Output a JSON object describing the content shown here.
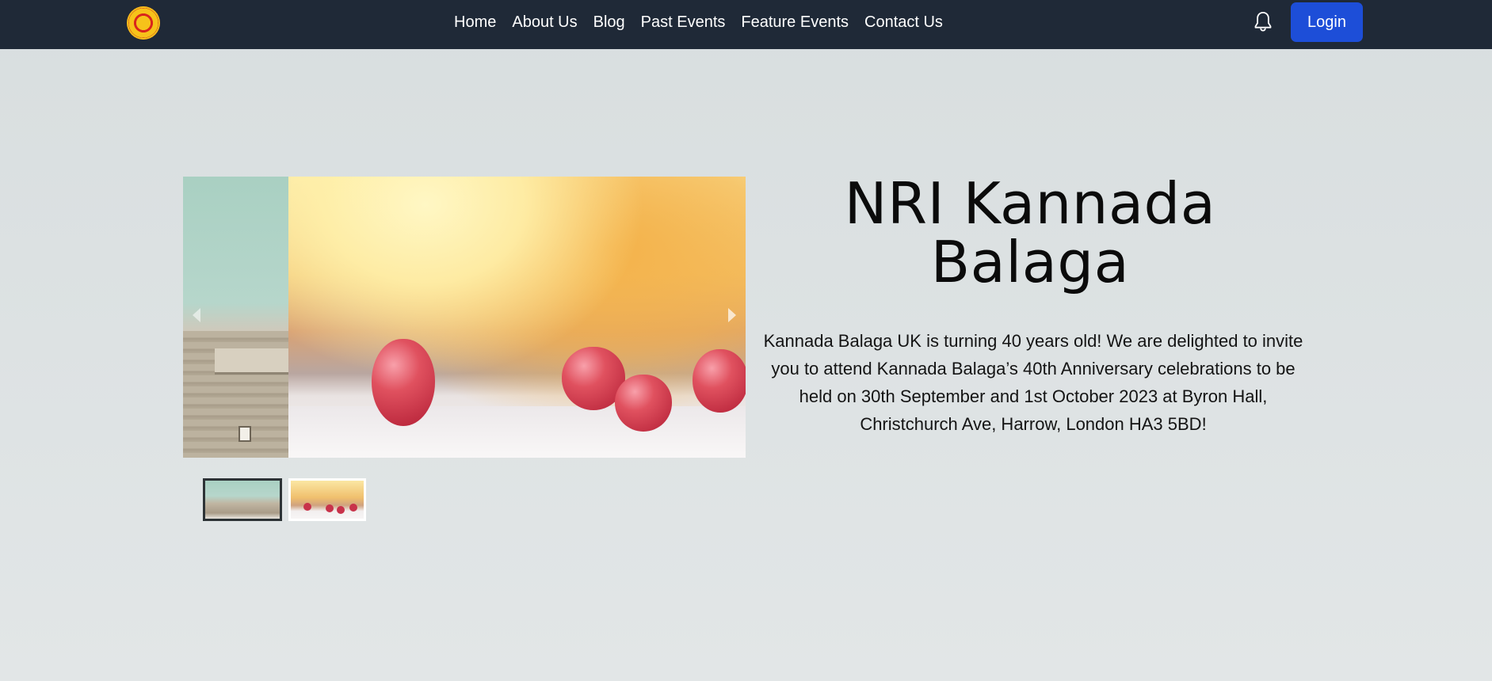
{
  "nav": {
    "links": [
      "Home",
      "About Us",
      "Blog",
      "Past Events",
      "Feature Events",
      "Contact Us"
    ],
    "login_label": "Login",
    "logo_icon": "kannada-balaga-logo",
    "bell_icon": "bell-icon",
    "background": "#1f2937",
    "login_color": "#1d4ed8"
  },
  "hero": {
    "title": "NRI Kannada Balaga",
    "description": "Kannada Balaga UK is turning 40 years old! We are delighted to invite you to attend Kannada Balaga’s 40th Anniversary celebrations to be held on 30th September and 1st October 2023 at Byron Hall, Christchurch Ave, Harrow, London HA3 5BD!"
  },
  "carousel": {
    "slide_count": 2,
    "active_thumbnail": 1,
    "prev_icon": "chevron-left-icon",
    "next_icon": "chevron-right-icon"
  }
}
